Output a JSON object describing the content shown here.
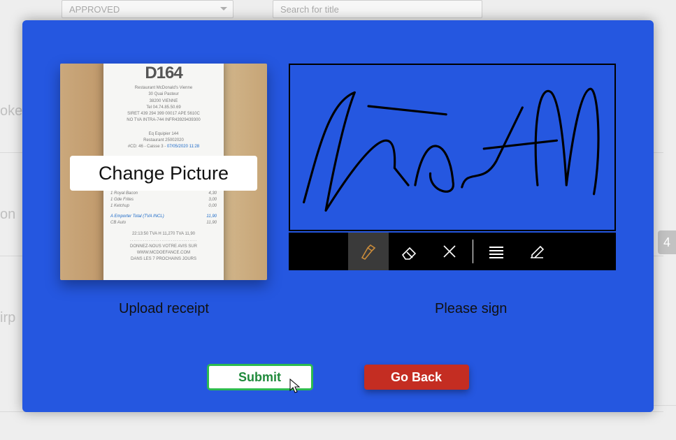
{
  "background": {
    "status_dropdown": "APPROVED",
    "search_placeholder": "Search for title",
    "side_hints": [
      "oke",
      "on",
      "irp"
    ],
    "right_badge": "4"
  },
  "modal": {
    "receipt": {
      "header": "D164",
      "header_lines": [
        "Restaurant McDonald's Vienne",
        "30 Quai Pasteur",
        "38200 VIENNE",
        "Tel 04.74.85.50.69",
        "SIRET 439 294 399 00017 APE 5610C",
        "NO TVA INTRA-744 INFR43929439300"
      ],
      "mid_lines": [
        "Eq Equipier 144",
        "Restaurant 25002020",
        "#CD: 46 - Caisse 3 -"
      ],
      "mid_hl": "07/05/2020 11:28",
      "items": [
        [
          "1 Royal Bacon",
          "4,30"
        ],
        [
          "1 Gde Frites",
          "3,00"
        ],
        [
          "1 Ketchup",
          "0,00"
        ]
      ],
      "total_line": [
        "A Emporter  Total (TVA INCL)",
        "11,90"
      ],
      "payment": [
        "CB Auto",
        "11,90"
      ],
      "time_line": "22:13:50   TVA H   11,270    TVA 11,90",
      "footer": [
        "DONNEZ-NOUS VOTRE AVIS SUR",
        "WWW.MCDOEFANCE.COM",
        "DANS LES 7 PROCHAINS JOURS"
      ],
      "change_button": "Change Picture",
      "caption": "Upload receipt"
    },
    "signature": {
      "caption": "Please sign",
      "tools": {
        "pen": "pen-icon",
        "eraser": "eraser-icon",
        "clear": "clear-icon",
        "lines": "line-weight-icon",
        "edit": "edit-icon"
      }
    },
    "buttons": {
      "submit": "Submit",
      "go_back": "Go Back"
    }
  }
}
